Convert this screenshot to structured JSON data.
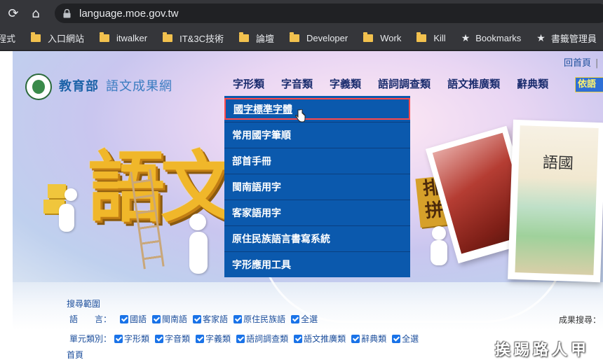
{
  "browser": {
    "url": "language.moe.gov.tw",
    "bookmarks": [
      {
        "label": "程式",
        "icon": "none"
      },
      {
        "label": "入口網站",
        "icon": "folder-icon"
      },
      {
        "label": "itwalker",
        "icon": "folder-icon"
      },
      {
        "label": "IT&3C技術",
        "icon": "folder-icon"
      },
      {
        "label": "論壇",
        "icon": "folder-icon"
      },
      {
        "label": "Developer",
        "icon": "folder-icon"
      },
      {
        "label": "Work",
        "icon": "folder-icon"
      },
      {
        "label": "Kill",
        "icon": "folder-icon"
      },
      {
        "label": "Bookmarks",
        "icon": "star-icon"
      },
      {
        "label": "書籤管理員",
        "icon": "star-icon"
      }
    ]
  },
  "site": {
    "org": "教育部",
    "name": "語文成果網",
    "home_link": "回首頁",
    "home_sep": "|"
  },
  "nav": {
    "items": [
      "字形類",
      "字音類",
      "字義類",
      "語詞調查類",
      "語文推廣類",
      "辭典類"
    ],
    "search_tag": "依語"
  },
  "dropdown": {
    "items": [
      "國字標準字體",
      "常用國字筆順",
      "部首手冊",
      "閩南語用字",
      "客家語用字",
      "原住民族語言書寫系統",
      "字形應用工具"
    ],
    "active_index": 0
  },
  "decor": {
    "big_text": "語文",
    "slab_text": "排拼",
    "book_title": "語國"
  },
  "search": {
    "range_label": "搜尋範圍",
    "lang_label": "語　　言：",
    "langs": [
      "國語",
      "閩南語",
      "客家語",
      "原住民族語",
      "全選"
    ],
    "unit_label": "單元類別：",
    "units": [
      "字形類",
      "字音類",
      "字義類",
      "語詞調查類",
      "語文推廣類",
      "辭典類",
      "全選"
    ],
    "results_label": "成果搜尋：",
    "home_bottom": "首頁"
  },
  "watermark": "挨踢路人甲",
  "colors": {
    "chrome_bg": "#35363a",
    "dropdown_bg": "#0b59ad",
    "nav_text": "#1a2c6e",
    "active_border": "#ff4a4a",
    "checkbox": "#1a73e8"
  }
}
